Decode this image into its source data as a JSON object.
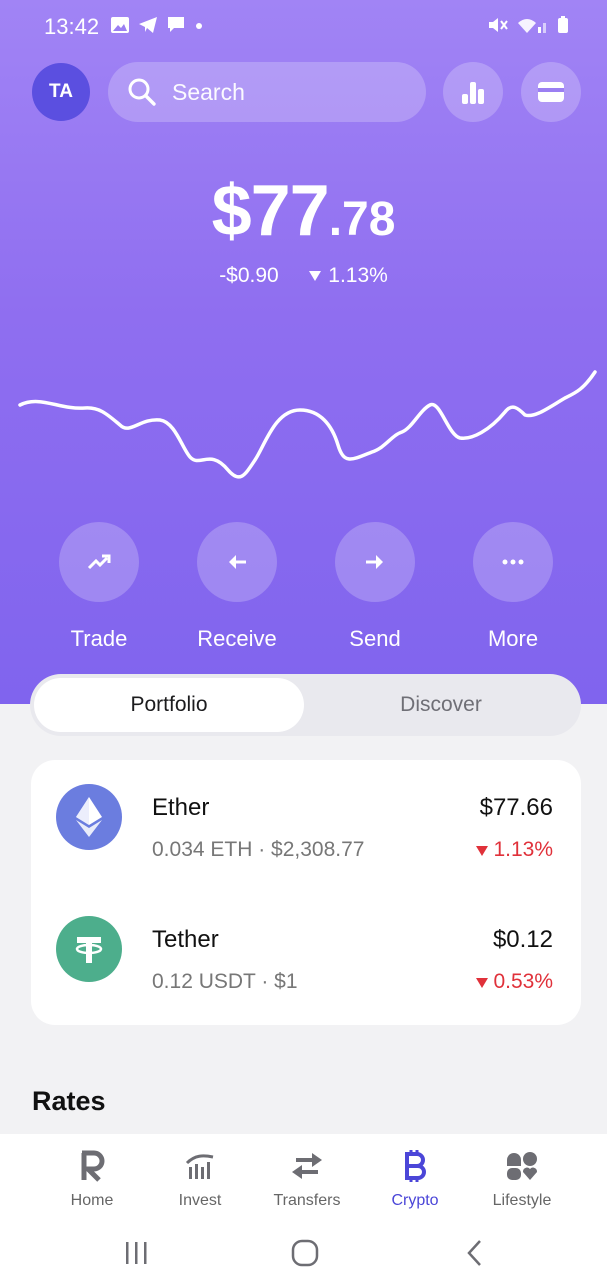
{
  "status_bar": {
    "time": "13:42"
  },
  "header": {
    "avatar_initials": "TA",
    "search_placeholder": "Search"
  },
  "balance": {
    "integer": "$77",
    "decimal": ".78",
    "change_amount": "-$0.90",
    "change_percent": "1.13%"
  },
  "actions": [
    {
      "label": "Trade",
      "icon": "trend-up-icon"
    },
    {
      "label": "Receive",
      "icon": "arrow-left-icon"
    },
    {
      "label": "Send",
      "icon": "arrow-right-icon"
    },
    {
      "label": "More",
      "icon": "more-dots-icon"
    }
  ],
  "tabs": {
    "portfolio": "Portfolio",
    "discover": "Discover",
    "active": "portfolio"
  },
  "assets": [
    {
      "name": "Ether",
      "sub": "0.034 ETH · $2,308.77",
      "value": "$77.66",
      "change": "1.13%",
      "icon": "ethereum-icon",
      "color": "#6b7ddf"
    },
    {
      "name": "Tether",
      "sub": "0.12 USDT · $1",
      "value": "$0.12",
      "change": "0.53%",
      "icon": "tether-icon",
      "color": "#4dae8c"
    }
  ],
  "rates_title": "Rates",
  "bottom_nav": [
    {
      "label": "Home",
      "icon": "revolut-r-icon"
    },
    {
      "label": "Invest",
      "icon": "invest-chart-icon"
    },
    {
      "label": "Transfers",
      "icon": "transfer-arrows-icon"
    },
    {
      "label": "Crypto",
      "icon": "bitcoin-icon",
      "active": true
    },
    {
      "label": "Lifestyle",
      "icon": "lifestyle-icon"
    }
  ],
  "colors": {
    "accent": "#8f6ef0",
    "negative": "#e0313a",
    "nav_active": "#4b46d8"
  }
}
